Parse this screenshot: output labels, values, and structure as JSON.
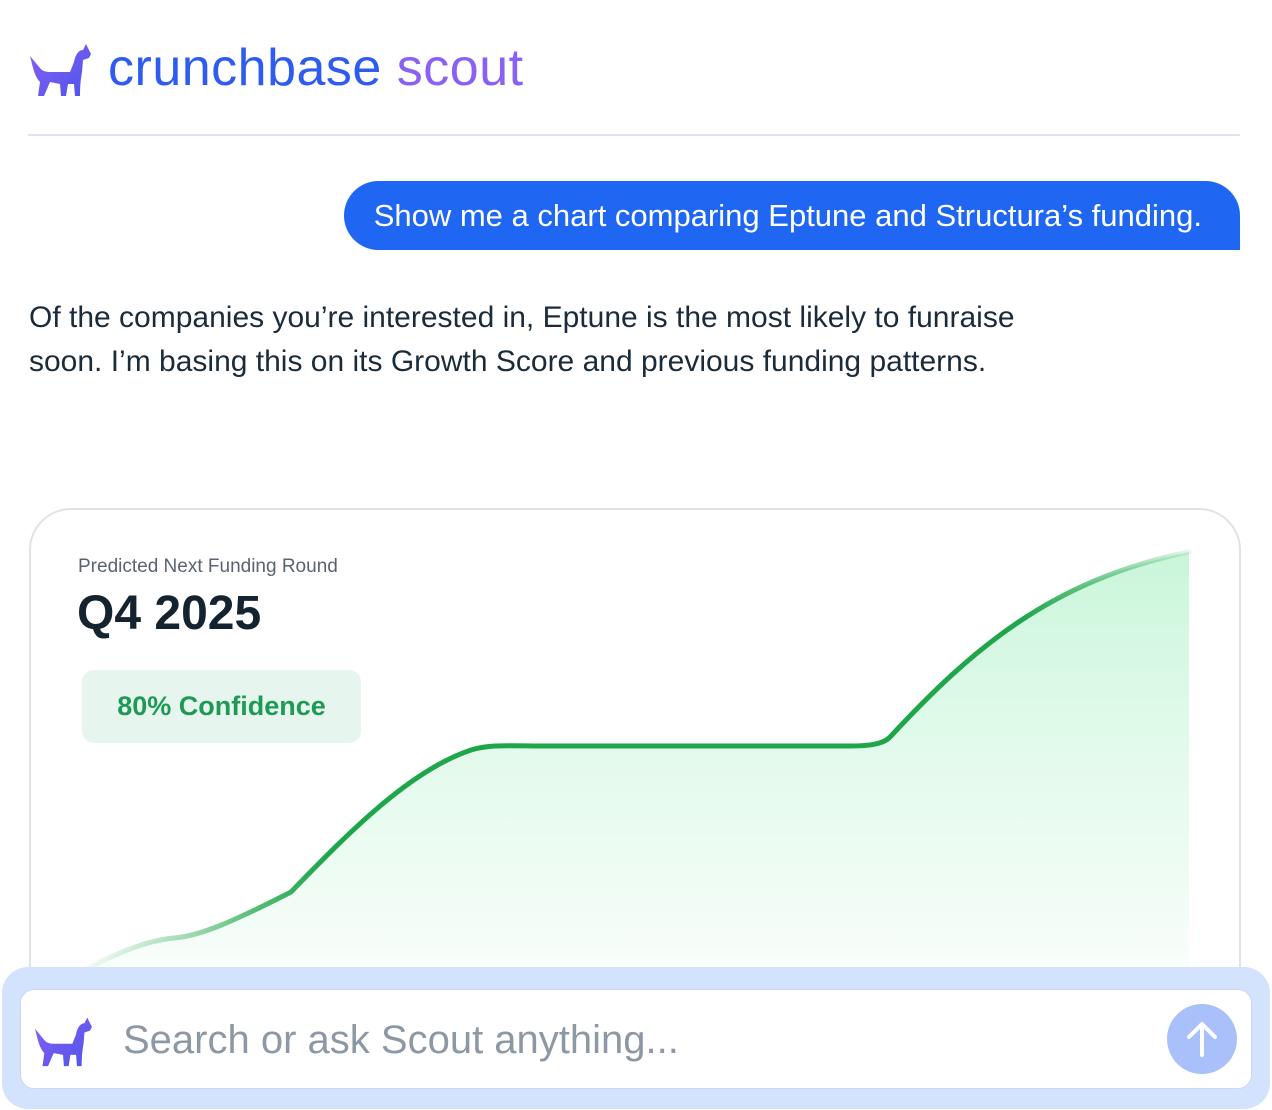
{
  "header": {
    "brand_part1": "crunchbase",
    "brand_part2": "scout"
  },
  "colors": {
    "accent_blue": "#1f66f2",
    "brand_purple": "#8a61f5",
    "chart_green": "#1fa64a",
    "confidence_green": "#1e9a56"
  },
  "icons": {
    "logo": "dog-logo-icon",
    "send": "arrow-up-icon"
  },
  "conversation": {
    "user_message": "Show me a chart comparing Eptune and Structura’s funding.",
    "assistant_response": "Of the companies you’re interested in, Eptune is the most likely to funraise soon. I’m basing this on its Growth Score and previous funding patterns."
  },
  "prediction_card": {
    "label": "Predicted Next Funding Round",
    "value": "Q4 2025",
    "confidence": "80% Confidence"
  },
  "search": {
    "placeholder": "Search or ask Scout anything..."
  }
}
